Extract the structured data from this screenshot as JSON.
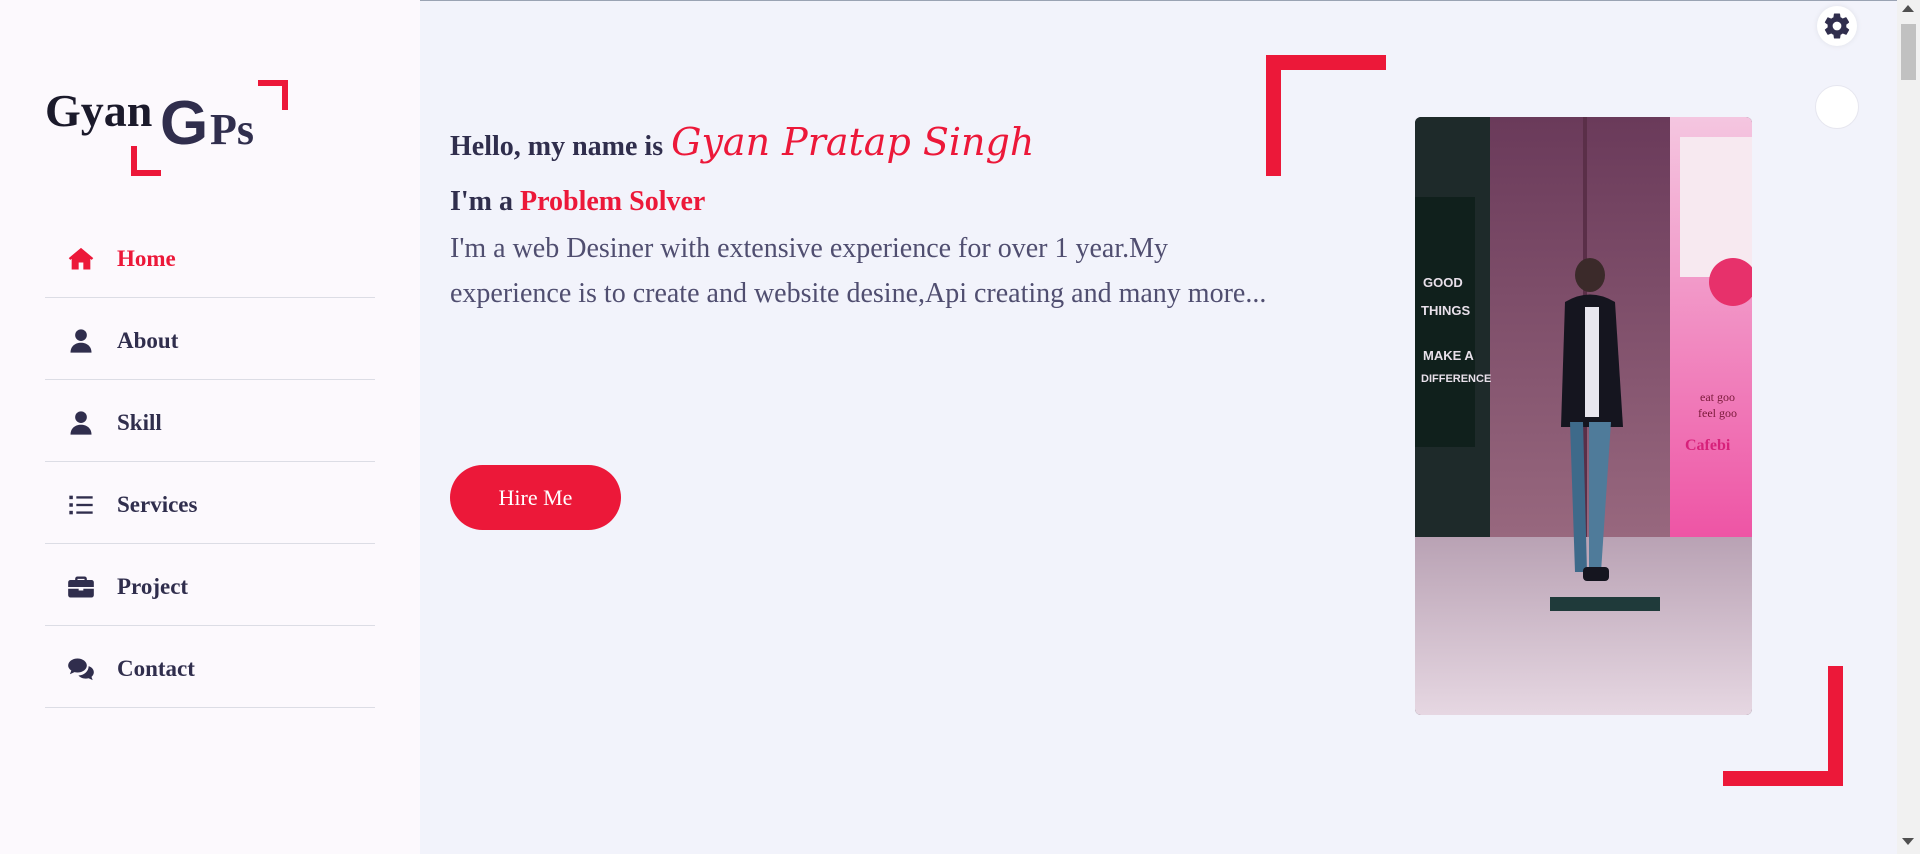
{
  "logo": {
    "text_gyan": "Gyan",
    "text_g": "G",
    "text_ps": "Ps"
  },
  "sidebar": {
    "items": [
      {
        "label": "Home",
        "icon": "home-icon",
        "active": true
      },
      {
        "label": "About",
        "icon": "user-icon",
        "active": false
      },
      {
        "label": "Skill",
        "icon": "user-icon",
        "active": false
      },
      {
        "label": "Services",
        "icon": "list-icon",
        "active": false
      },
      {
        "label": "Project",
        "icon": "briefcase-icon",
        "active": false
      },
      {
        "label": "Contact",
        "icon": "comments-icon",
        "active": false
      }
    ]
  },
  "home": {
    "greeting": "Hello, my name is",
    "name": "Gyan Pratap Singh",
    "profession_prefix": "I'm a",
    "profession": "Problem Solver",
    "description": "I'm a web Desiner with extensive experience for over 1 year.My experience is to create and website desine,Api creating and many more...",
    "hire_button": "Hire Me"
  },
  "style_switcher": {
    "icon": "gear-icon",
    "day_night_icon": "day-night-toggle"
  },
  "colors": {
    "accent": "#ec1839",
    "text_dark": "#302e4d",
    "text_body": "#504e70",
    "main_bg": "#f2f3fb",
    "sidebar_bg": "#fcf9fd"
  }
}
